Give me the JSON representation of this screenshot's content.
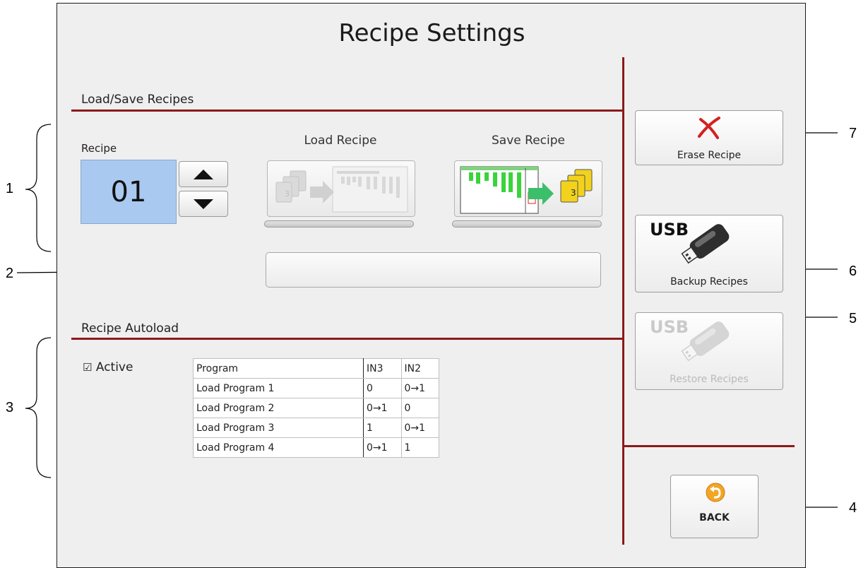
{
  "title": "Recipe Settings",
  "load_save": {
    "section_title": "Load/Save Recipes",
    "recipe_label": "Recipe",
    "recipe_value": "01",
    "load_label": "Load Recipe",
    "save_label": "Save Recipe"
  },
  "autoload": {
    "section_title": "Recipe Autoload",
    "active_label": "Active",
    "active_checked": true,
    "checkbox_glyph": "☑",
    "headers": [
      "Program",
      "IN3",
      "IN2"
    ],
    "rows": [
      [
        "Load Program 1",
        "0",
        "0→1"
      ],
      [
        "Load Program 2",
        "0→1",
        "0"
      ],
      [
        "Load Program 3",
        "1",
        "0→1"
      ],
      [
        "Load Program 4",
        "0→1",
        "1"
      ]
    ]
  },
  "side": {
    "erase_label": "Erase Recipe",
    "backup_label": "Backup Recipes",
    "restore_label": "Restore Recipes",
    "usb_text": "USB",
    "back_label": "BACK"
  },
  "callouts": {
    "c1": "1",
    "c2": "2",
    "c3": "3",
    "c4": "4",
    "c5": "5",
    "c6": "6",
    "c7": "7"
  },
  "colors": {
    "accent_rule": "#8b1a1a",
    "recipe_field": "#a9c9f0",
    "erase_x": "#d42020"
  }
}
